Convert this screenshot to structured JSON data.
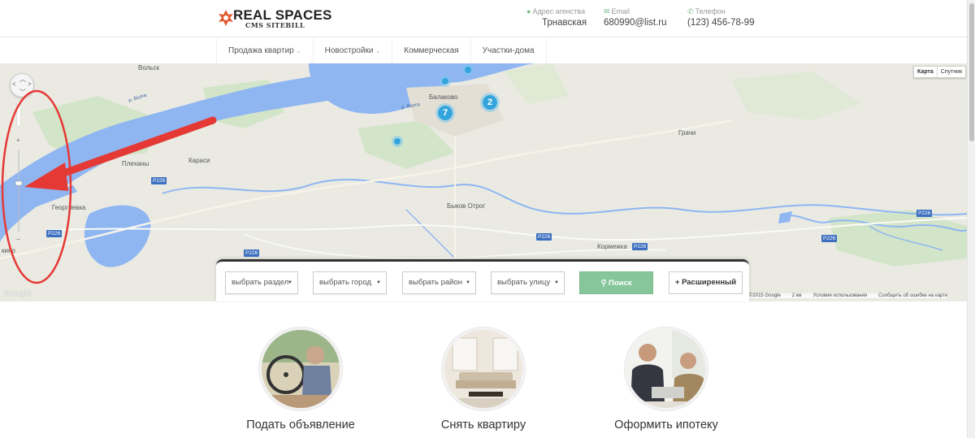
{
  "header": {
    "logo_title": "REAL SPACES",
    "logo_subtitle": "CMS SITEBILL",
    "contacts": [
      {
        "icon": "map-marker-icon",
        "label": "Адрес агенства",
        "value": "Трнавская"
      },
      {
        "icon": "envelope-icon",
        "label": "Email",
        "value": "680990@list.ru"
      },
      {
        "icon": "phone-icon",
        "label": "Телефон",
        "value": "(123) 456-78-99"
      }
    ]
  },
  "nav": {
    "items": [
      {
        "label": "Продажа квартир",
        "has_dropdown": true
      },
      {
        "label": "Новостройки",
        "has_dropdown": true
      },
      {
        "label": "Коммерческая",
        "has_dropdown": false
      },
      {
        "label": "Участки-дома",
        "has_dropdown": false
      }
    ]
  },
  "map": {
    "type_buttons": {
      "map": "Карта",
      "satellite": "Спутник",
      "active": "Карта"
    },
    "labels": {
      "volsk": "Вольск",
      "balakovo": "Балаково",
      "grachi": "Грачи",
      "plekhany": "Плеханы",
      "karasi": "Караси",
      "georgievka": "Георгиевка",
      "bykov_otrog": "Быков Отрог",
      "kormezhka": "Кормежка",
      "kino": "кино",
      "river": "р. Волга",
      "river2": "р. Волга"
    },
    "road": "Р226",
    "clusters": [
      "7",
      "2"
    ],
    "google": "Google",
    "attribution": {
      "data": "©2015 Google",
      "scale": "2 км",
      "terms": "Условия использования",
      "report": "Сообщить об ошибке на карте"
    }
  },
  "search": {
    "section": "выбрать раздел",
    "city": "выбрать город",
    "district": "выбрать район",
    "street": "выбрать улицу",
    "search_button": "Поиск",
    "advanced_button": "Расширенный"
  },
  "features": [
    {
      "title": "Подать объявление"
    },
    {
      "title": "Снять квартиру"
    },
    {
      "title": "Оформить ипотеку"
    }
  ],
  "colors": {
    "accent_green": "#86c69a",
    "cluster_blue": "#33a4dc",
    "water": "#8fb6f1",
    "annotation_red": "#e53935"
  }
}
